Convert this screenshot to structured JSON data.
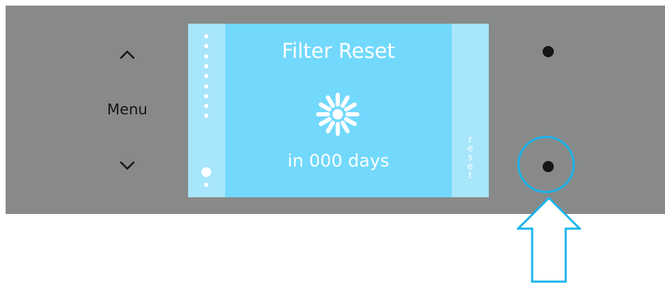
{
  "panel": {
    "menu_label": "Menu",
    "buttons": {
      "up": "chevron-up-icon",
      "down": "chevron-down-icon",
      "top_right": "button-dot-icon",
      "bottom_right": "button-dot-icon"
    }
  },
  "screen": {
    "title": "Filter Reset",
    "subtitle": "in 000 days",
    "icon": "filter-icon",
    "side_label": "reset",
    "page_indicator": {
      "total": 10,
      "active": 10
    }
  },
  "annotation": {
    "highlight": "highlight-ring",
    "pointer": "up-arrow-icon"
  },
  "colors": {
    "panel": "#888a89",
    "screen": "#72d9fc",
    "screen_side": "#a8e6fc",
    "highlight": "#19b4ec",
    "text": "#ffffff",
    "button": "#151515"
  }
}
